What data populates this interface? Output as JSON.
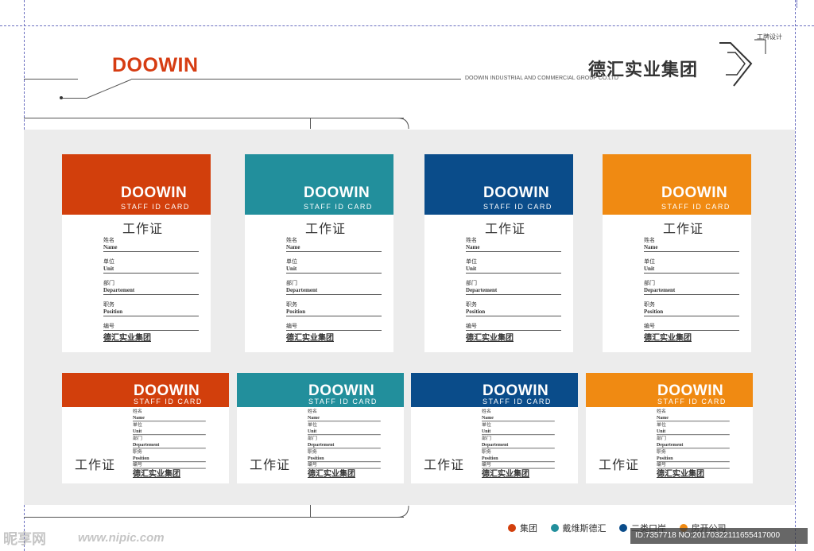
{
  "header": {
    "logo_text": "DOOWIN",
    "group_name_cn": "德汇实业集团",
    "group_name_en": "DOOWIN INDUSTRIAL AND COMMERCIAL GROUP CO.LTD",
    "tag": "工牌设计"
  },
  "card_common": {
    "logo": "DOOWIN",
    "sub": "STAFF ID CARD",
    "title": "工作证",
    "company": "德汇实业集团",
    "fields": [
      {
        "cn": "姓名",
        "en": "Name"
      },
      {
        "cn": "单位",
        "en": "Unit"
      },
      {
        "cn": "部门",
        "en": "Departement"
      },
      {
        "cn": "职务",
        "en": "Position"
      },
      {
        "cn": "编号",
        "en": ""
      }
    ]
  },
  "colors": {
    "red": "#d23f0c",
    "teal": "#228f9c",
    "navy": "#0a4c8a",
    "orange": "#f08a12"
  },
  "legend": [
    {
      "label": "集团",
      "color": "#d23f0c"
    },
    {
      "label": "戴维斯德汇",
      "color": "#228f9c"
    },
    {
      "label": "二类口岸",
      "color": "#0a4c8a"
    },
    {
      "label": "房开公司",
      "color": "#f08a12"
    }
  ],
  "watermark": {
    "site_cn": "昵享网",
    "url": "www.nipic.com",
    "id_text": "ID:7357718 NO:20170322111655417000"
  }
}
